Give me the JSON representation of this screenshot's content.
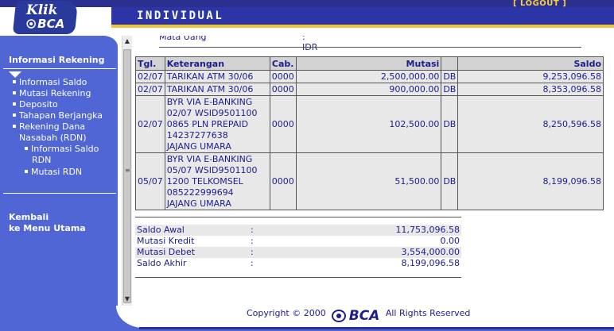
{
  "header": {
    "logo_line1": "Klik",
    "logo_line2": "BCA",
    "page_label": "INDIVIDUAL",
    "logout_label": "[ LOGOUT ]"
  },
  "sidebar": {
    "title": "Informasi Rekening",
    "items": [
      {
        "label": "Informasi Saldo"
      },
      {
        "label": "Mutasi Rekening"
      },
      {
        "label": "Deposito"
      },
      {
        "label": "Tahapan Berjangka"
      },
      {
        "label": "Rekening Dana"
      },
      {
        "label": "Nasabah (RDN)"
      }
    ],
    "subitems": [
      {
        "label": "Informasi Saldo"
      },
      {
        "label": "RDN"
      },
      {
        "label": "Mutasi RDN"
      }
    ],
    "back_line1": "Kembali",
    "back_line2": "ke Menu Utama"
  },
  "account": {
    "partial_label": "Mata Uang",
    "partial_value": ": IDR"
  },
  "table": {
    "headers": {
      "date": "Tgl.",
      "description": "Keterangan",
      "branch": "Cab.",
      "amount": "Mutasi",
      "balance": "Saldo"
    },
    "rows": [
      {
        "date": "02/07",
        "desc": [
          "TARIKAN ATM 30/06"
        ],
        "branch": "0000",
        "amount": "2,500,000.00",
        "type": "DB",
        "balance": "9,253,096.58"
      },
      {
        "date": "02/07",
        "desc": [
          "TARIKAN ATM 30/06"
        ],
        "branch": "0000",
        "amount": "900,000.00",
        "type": "DB",
        "balance": "8,353,096.58"
      },
      {
        "date": "02/07",
        "desc": [
          "BYR VIA E-BANKING",
          "02/07 WSID9501100",
          "0865 PLN PREPAID",
          "14237277638",
          "JAJANG UMARA"
        ],
        "branch": "0000",
        "amount": "102,500.00",
        "type": "DB",
        "balance": "8,250,596.58"
      },
      {
        "date": "05/07",
        "desc": [
          "BYR VIA E-BANKING",
          "05/07 WSID9501100",
          "1200 TELKOMSEL",
          "085222999694",
          "JAJANG UMARA"
        ],
        "branch": "0000",
        "amount": "51,500.00",
        "type": "DB",
        "balance": "8,199,096.58"
      }
    ]
  },
  "summary": [
    {
      "label": "Saldo Awal",
      "colon": ":",
      "value": "11,753,096.58"
    },
    {
      "label": "Mutasi Kredit",
      "colon": ":",
      "value": "0.00"
    },
    {
      "label": "Mutasi Debet",
      "colon": ":",
      "value": "3,554,000.00"
    },
    {
      "label": "Saldo Akhir",
      "colon": ":",
      "value": "8,199,096.58"
    }
  ],
  "footer": {
    "copyright": "Copyright © 2000",
    "brand": "BCA",
    "rights": "All Rights Reserved"
  },
  "colors": {
    "banner_dark": "#2b2f8f",
    "banner_blue": "#2b35a5",
    "accent_gold": "#f1c232",
    "menu_blue": "#4f66d4",
    "text_navy": "#1d1d8c",
    "table_header": "#d3d3d3",
    "table_cell": "#e8e8e8"
  }
}
